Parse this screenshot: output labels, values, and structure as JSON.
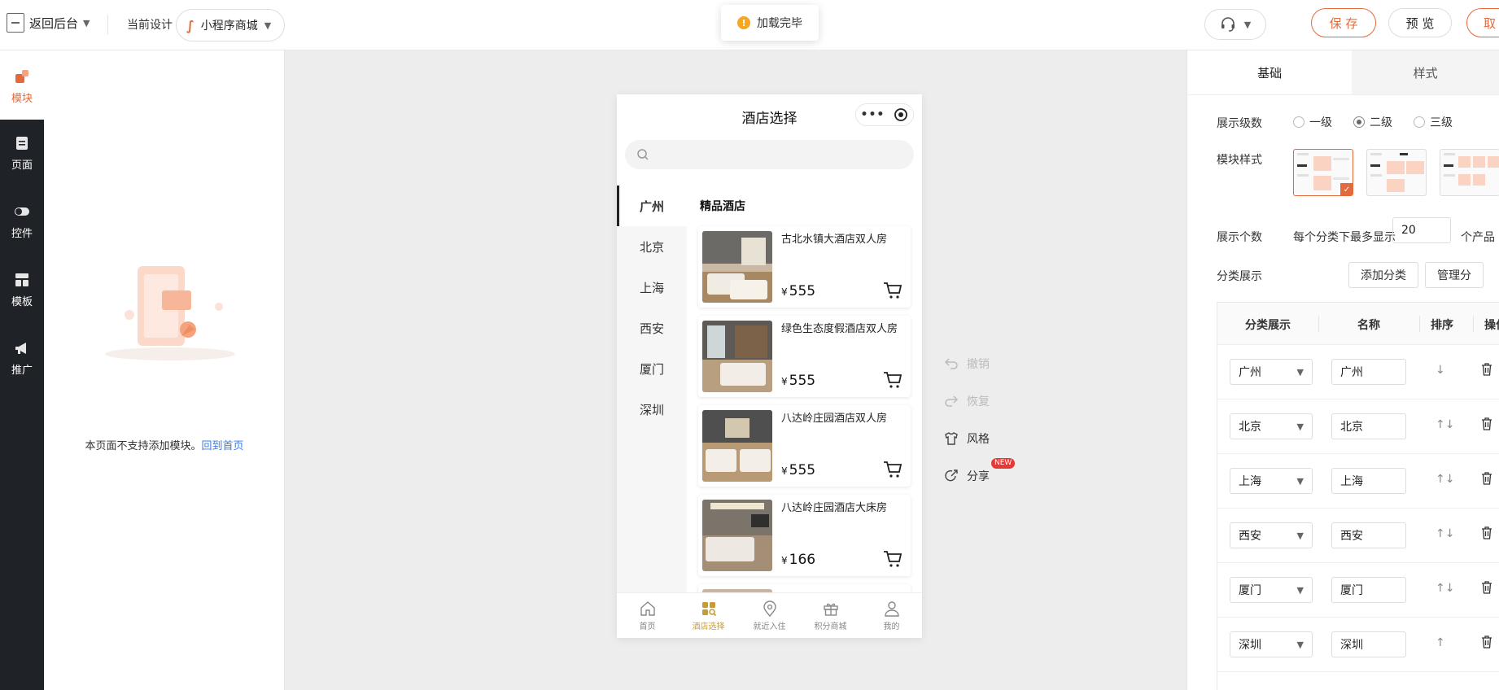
{
  "topbar": {
    "back_label": "返回后台",
    "current_design_label": "当前设计",
    "design_select_value": "小程序商城",
    "toast": "加载完毕",
    "save": "保 存",
    "preview": "预 览",
    "cancel": "取"
  },
  "sidebar": {
    "items": [
      {
        "label": "模块",
        "icon": "module-icon",
        "active": true
      },
      {
        "label": "页面",
        "icon": "page-icon",
        "active": false
      },
      {
        "label": "控件",
        "icon": "toggle-icon",
        "active": false
      },
      {
        "label": "模板",
        "icon": "template-icon",
        "active": false
      },
      {
        "label": "推广",
        "icon": "megaphone-icon",
        "active": false
      }
    ]
  },
  "leftpanel": {
    "message": "本页面不支持添加模块。",
    "link": "回到首页"
  },
  "phone": {
    "title": "酒店选择",
    "search_placeholder": "",
    "categories": [
      "广州",
      "北京",
      "上海",
      "西安",
      "厦门",
      "深圳"
    ],
    "section_title": "精品酒店",
    "currency": "¥",
    "products": [
      {
        "name": "古北水镇大酒店双人房",
        "price": "555"
      },
      {
        "name": "绿色生态度假酒店双人房",
        "price": "555"
      },
      {
        "name": "八达岭庄园酒店双人房",
        "price": "555"
      },
      {
        "name": "八达岭庄园酒店大床房",
        "price": "166"
      },
      {
        "name": "",
        "price": ""
      }
    ],
    "tabs": [
      {
        "label": "首页",
        "icon": "home-icon",
        "active": false
      },
      {
        "label": "酒店选择",
        "icon": "grid-search-icon",
        "active": true
      },
      {
        "label": "就近入住",
        "icon": "location-icon",
        "active": false
      },
      {
        "label": "积分商城",
        "icon": "gift-icon",
        "active": false
      },
      {
        "label": "我的",
        "icon": "user-icon",
        "active": false
      }
    ]
  },
  "float_actions": {
    "undo": "撤销",
    "redo": "恢复",
    "style": "风格",
    "share": "分享",
    "new_badge": "NEW"
  },
  "rightpanel": {
    "tabs": [
      "基础",
      "样式"
    ],
    "levels_label": "展示级数",
    "levels": [
      "一级",
      "二级",
      "三级"
    ],
    "levels_selected": "二级",
    "module_style_label": "模块样式",
    "count_label": "展示个数",
    "count_prefix": "每个分类下最多显示",
    "count_value": "20",
    "count_suffix": "个产品",
    "category_label": "分类展示",
    "add_category": "添加分类",
    "manage_category": "管理分",
    "table_headers": [
      "分类展示",
      "名称",
      "排序",
      "操作"
    ],
    "rows": [
      {
        "select": "广州",
        "name": "广州",
        "sort": "↓"
      },
      {
        "select": "北京",
        "name": "北京",
        "sort": "↑↓"
      },
      {
        "select": "上海",
        "name": "上海",
        "sort": "↑↓"
      },
      {
        "select": "西安",
        "name": "西安",
        "sort": "↑↓"
      },
      {
        "select": "厦门",
        "name": "厦门",
        "sort": "↑↓"
      },
      {
        "select": "深圳",
        "name": "深圳",
        "sort": "↑"
      }
    ]
  },
  "colors": {
    "accent": "#e36a3b",
    "sidebar_bg": "#1f2226",
    "tab_active": "#c79a3a",
    "warning": "#f5a623",
    "link": "#3c7be0"
  }
}
